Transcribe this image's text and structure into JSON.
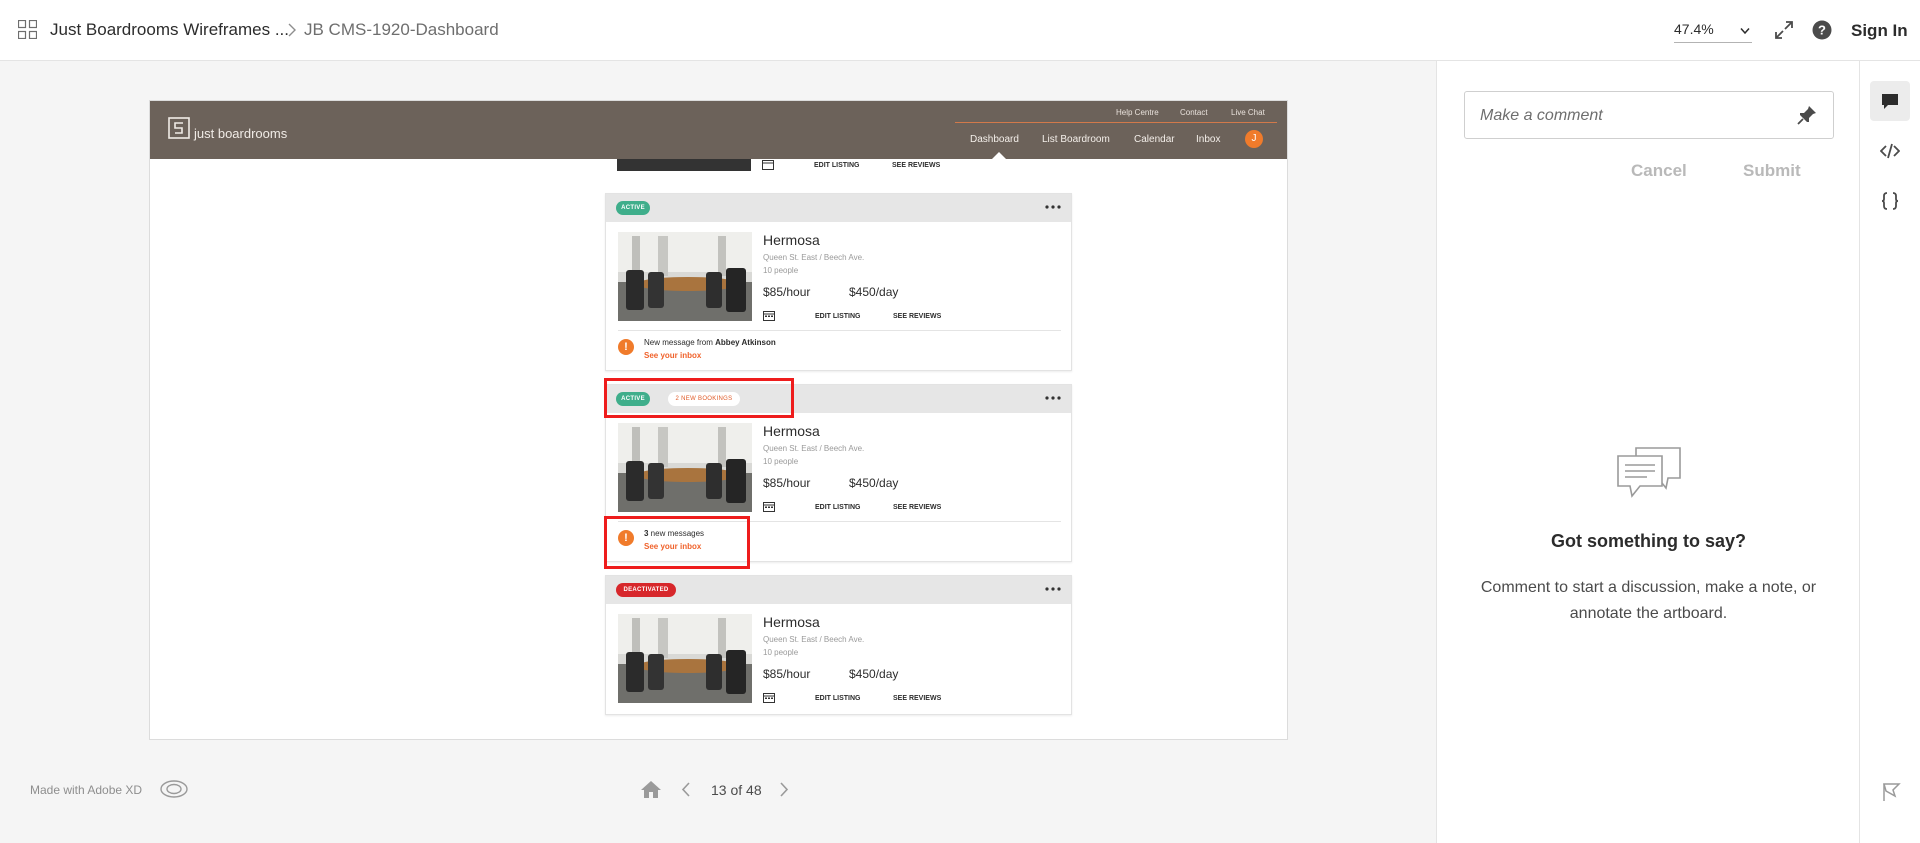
{
  "topbar": {
    "project_title": "Just Boardrooms Wireframes ...",
    "artboard_title": "JB CMS-1920-Dashboard",
    "zoom_value": "47.4%",
    "sign_in_label": "Sign In",
    "icons": [
      "grid-icon",
      "chevron-right-icon",
      "chevron-down-icon",
      "expand-icon",
      "help-icon"
    ]
  },
  "artboard": {
    "site": {
      "logo_text": "just boardrooms",
      "utility_links": [
        "Help Centre",
        "Contact",
        "Live Chat"
      ],
      "nav_items": [
        "Dashboard",
        "List Boardroom",
        "Calendar",
        "Inbox"
      ],
      "active_nav": "Dashboard",
      "avatar_initial": "J"
    },
    "top_remnant": {
      "edit_label": "EDIT LISTING",
      "reviews_label": "SEE REVIEWS"
    },
    "listings": [
      {
        "status": "ACTIVE",
        "status_color": "#3fae8b",
        "badge": "",
        "title": "Hermosa",
        "address": "Queen St. East / Beech Ave.",
        "capacity": "10 people",
        "price_hour": "$85/hour",
        "price_day": "$450/day",
        "edit_label": "EDIT LISTING",
        "reviews_label": "SEE REVIEWS",
        "alert": {
          "prefix": "New message from ",
          "strong": "Abbey Atkinson",
          "suffix": "",
          "link": "See your inbox"
        }
      },
      {
        "status": "ACTIVE",
        "status_color": "#3fae8b",
        "badge": "2 NEW BOOKINGS",
        "title": "Hermosa",
        "address": "Queen St. East / Beech Ave.",
        "capacity": "10 people",
        "price_hour": "$85/hour",
        "price_day": "$450/day",
        "edit_label": "EDIT LISTING",
        "reviews_label": "SEE REVIEWS",
        "alert": {
          "prefix": "",
          "strong": "3",
          "suffix": " new messages",
          "link": "See your inbox"
        }
      },
      {
        "status": "DEACTIVATED",
        "status_color": "#d7272b",
        "badge": "",
        "title": "Hermosa",
        "address": "Queen St. East / Beech Ave.",
        "capacity": "10 people",
        "price_hour": "$85/hour",
        "price_day": "$450/day",
        "edit_label": "EDIT LISTING",
        "reviews_label": "SEE REVIEWS"
      }
    ]
  },
  "footer": {
    "made_with": "Made with Adobe XD",
    "pager": "13 of 48"
  },
  "comments": {
    "placeholder": "Make a comment",
    "cancel_label": "Cancel",
    "submit_label": "Submit",
    "empty_title": "Got something to say?",
    "empty_body": "Comment to start a discussion, make a note, or annotate the artboard."
  },
  "rail": {
    "items": [
      "comment-icon",
      "code-icon",
      "braces-icon"
    ],
    "active": "comment-icon",
    "bottom": "flag-icon"
  },
  "colors": {
    "site_header": "#6c625a",
    "accent_orange": "#f07b2b",
    "highlight_red": "#ee1c1c",
    "active_green": "#3fae8b",
    "deactivated_red": "#d7272b"
  }
}
